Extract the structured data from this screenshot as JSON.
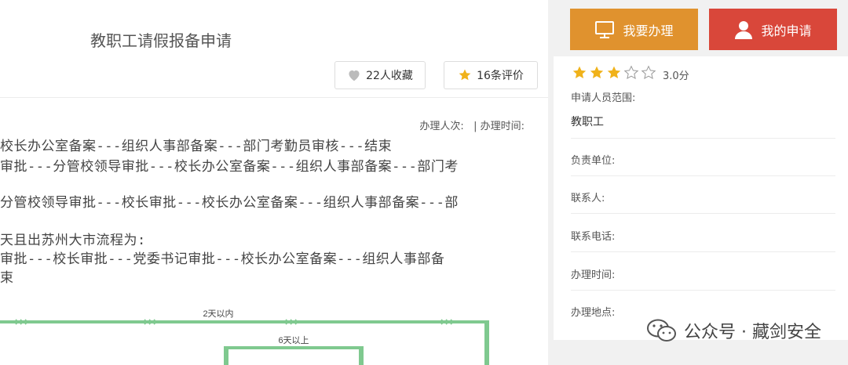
{
  "main": {
    "title": "教职工请假报备申请",
    "favorites": "22人收藏",
    "reviews": "16条评价",
    "meta_line": "办理人次:   | 办理时间:",
    "flow_lines": [
      "校长办公室备案---组织人事部备案---部门考勤员审核---结束",
      "审批---分管校领导审批---校长办公室备案---组织人事部备案---部门考",
      "分管校领导审批---校长审批---校长办公室备案---组织人事部备案---部",
      "天且出苏州大市流程为:",
      "审批---校长审批---党委书记审批---校长办公室备案---组织人事部备",
      "束"
    ],
    "diagram": {
      "label_top": "2天以内",
      "label_inner": "6天以上"
    }
  },
  "actions": {
    "apply": "我要办理",
    "mine": "我的申请"
  },
  "sidebar": {
    "rating_stars": 3,
    "rating_max": 5,
    "rating_text": "3.0分",
    "fields": [
      {
        "label": "申请人员范围:",
        "value": "教职工"
      },
      {
        "label": "负责单位:",
        "value": ""
      },
      {
        "label": "联系人:",
        "value": ""
      },
      {
        "label": "联系电话:",
        "value": ""
      },
      {
        "label": "办理时间:",
        "value": ""
      },
      {
        "label": "办理地点:",
        "value": ""
      }
    ]
  },
  "watermark": "公众号 · 藏剑安全",
  "colors": {
    "apply": "#e0922e",
    "mine": "#d9473a",
    "star": "#f0b21a",
    "flow_green": "#7fc98f"
  }
}
